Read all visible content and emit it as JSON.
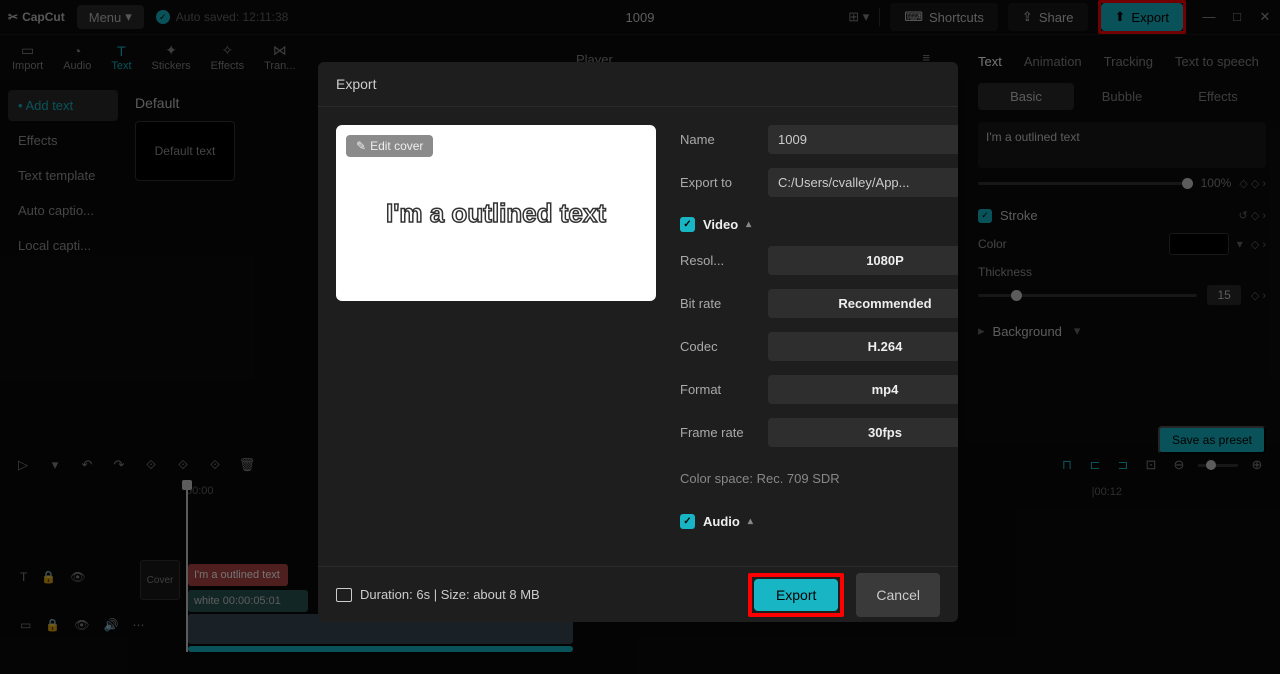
{
  "app": {
    "name": "CapCut",
    "menu": "Menu",
    "autosave": "Auto saved: 12:11:38",
    "title": "1009"
  },
  "topbar": {
    "shortcuts": "Shortcuts",
    "share": "Share",
    "export": "Export"
  },
  "tools": {
    "import": "Import",
    "audio": "Audio",
    "text": "Text",
    "stickers": "Stickers",
    "effects": "Effects",
    "transitions": "Tran..."
  },
  "player": "Player",
  "sidebar": {
    "items": [
      "Add text",
      "Effects",
      "Text template",
      "Auto captio...",
      "Local capti..."
    ]
  },
  "default": {
    "label": "Default",
    "thumb": "Default text"
  },
  "rightPanel": {
    "tabs": [
      "Text",
      "Animation",
      "Tracking",
      "Text to speech"
    ],
    "subtabs": [
      "Basic",
      "Bubble",
      "Effects"
    ],
    "textarea": "I'm a outlined text",
    "zoom": "100%",
    "stroke": "Stroke",
    "color": "Color",
    "thickness": "Thickness",
    "thicknessVal": "15",
    "background": "Background",
    "savePreset": "Save as preset"
  },
  "timeline": {
    "start": "00:00",
    "end": "|00:12",
    "cover": "Cover",
    "clipText": "I'm a outlined text",
    "clipWhite": "white   00:00:05:01"
  },
  "modal": {
    "title": "Export",
    "editCover": "Edit cover",
    "previewText": "I'm a outlined text",
    "name": {
      "label": "Name",
      "value": "1009"
    },
    "exportTo": {
      "label": "Export to",
      "value": "C:/Users/cvalley/App..."
    },
    "video": "Video",
    "resolution": {
      "label": "Resol...",
      "value": "1080P"
    },
    "bitrate": {
      "label": "Bit rate",
      "value": "Recommended"
    },
    "codec": {
      "label": "Codec",
      "value": "H.264"
    },
    "format": {
      "label": "Format",
      "value": "mp4"
    },
    "framerate": {
      "label": "Frame rate",
      "value": "30fps"
    },
    "colorspace": "Color space: Rec. 709 SDR",
    "audio": "Audio",
    "duration": "Duration: 6s | Size: about 8 MB",
    "exportBtn": "Export",
    "cancelBtn": "Cancel"
  }
}
